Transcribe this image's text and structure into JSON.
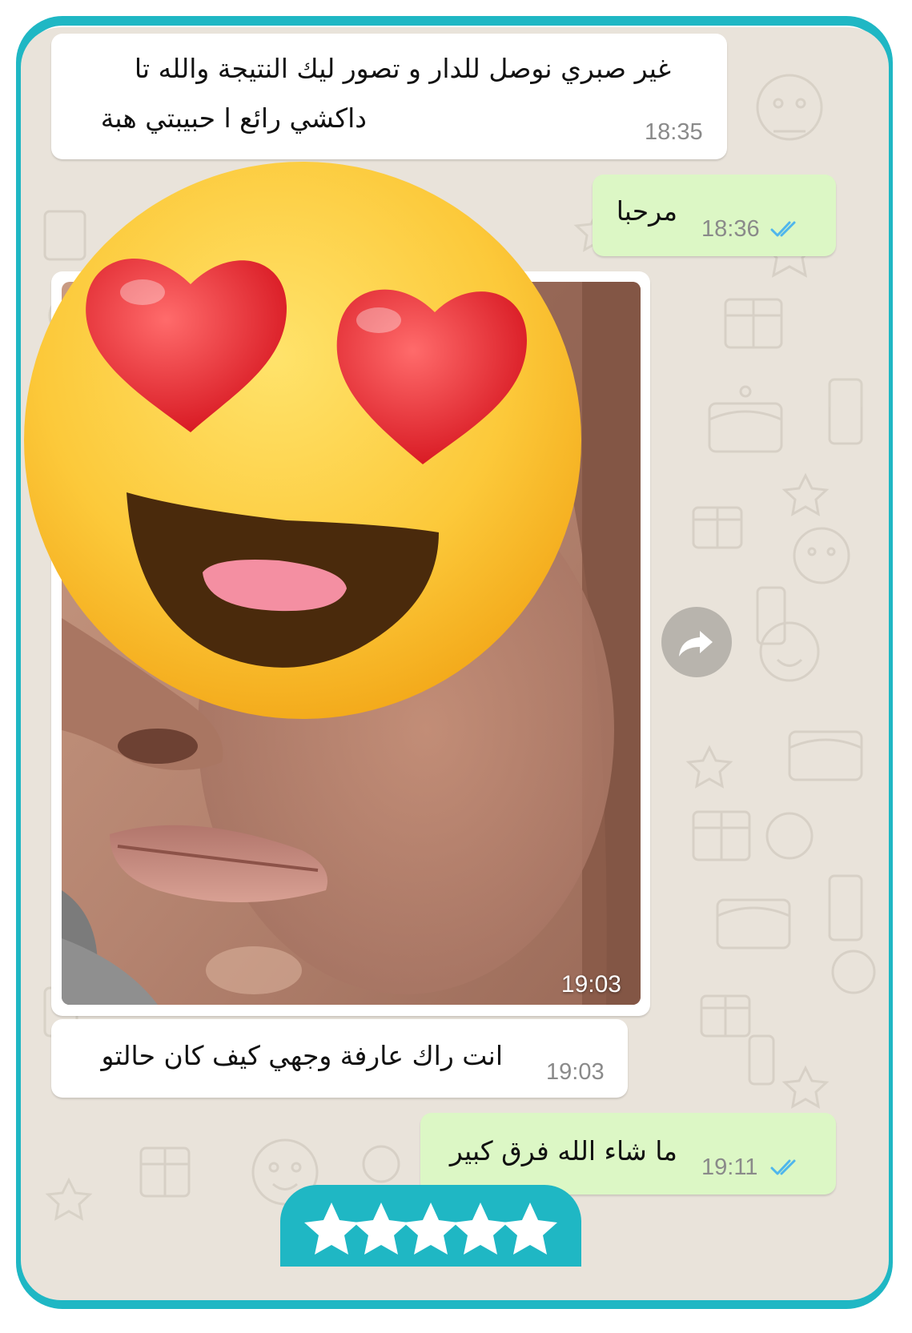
{
  "messages": [
    {
      "direction": "incoming",
      "text_line1": "غير صبري نوصل للدار و تصور ليك النتيجة والله تا",
      "text_line2": "داكشي رائع ا حبيبتي هبة",
      "time": "18:35"
    },
    {
      "direction": "outgoing",
      "text": "مرحبا",
      "time": "18:36",
      "status": "read"
    },
    {
      "direction": "incoming",
      "type": "image",
      "time": "19:03"
    },
    {
      "direction": "incoming",
      "text": "انت راك عارفة وجهي كيف كان حالتو",
      "time": "19:03"
    },
    {
      "direction": "outgoing",
      "text": "ما شاء الله فرق كبير",
      "time": "19:11",
      "status": "read"
    }
  ],
  "rating": {
    "stars": 5,
    "max": 5
  },
  "icons": {
    "forward": "forward-arrow-icon",
    "read_receipt": "double-check-icon",
    "star": "star-icon",
    "overlay_emoji": "heart-eyes-emoji-icon"
  },
  "colors": {
    "frame": "#1fb7c4",
    "chat_background": "#e9e3da",
    "incoming_bubble": "#ffffff",
    "outgoing_bubble": "#dcf7c5",
    "read_tick": "#4fb6ec"
  }
}
